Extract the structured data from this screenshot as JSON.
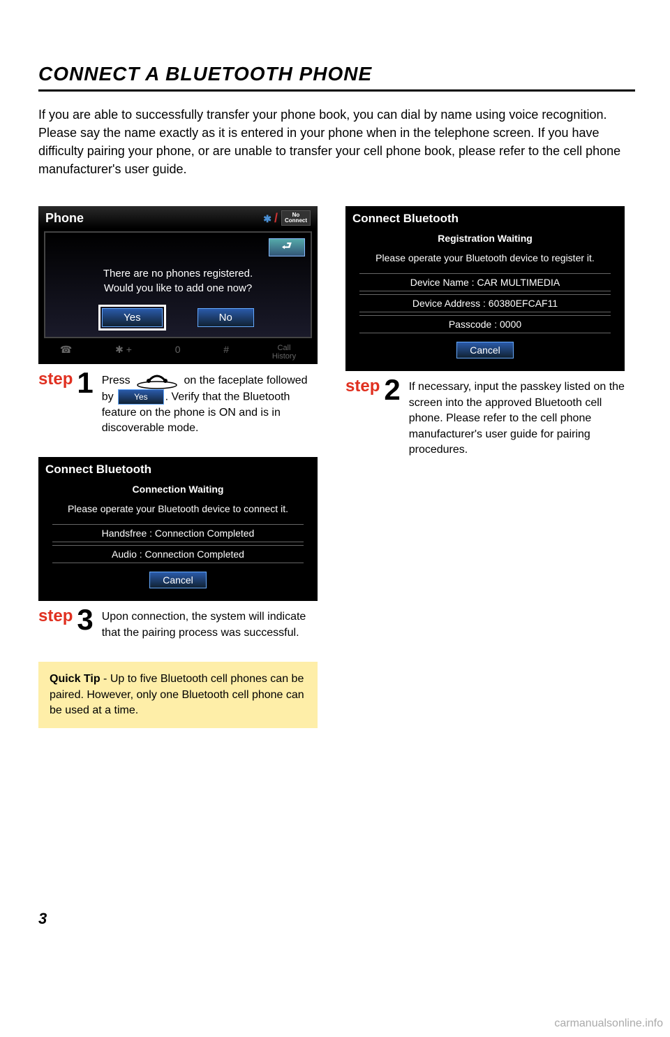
{
  "title": "CONNECT A BLUETOOTH PHONE",
  "intro": "If you are able to successfully transfer your phone book, you can dial by name using voice recognition. Please say the name exactly as it is entered in your phone when in the telephone screen. If you have difficulty pairing your phone, or are unable to transfer your cell phone book, please refer to the cell phone manufacturer's user guide.",
  "screenshot1": {
    "header": "Phone",
    "no_connect": "No\nConnect",
    "line1": "There are no phones registered.",
    "line2": "Would you like to add one now?",
    "yes": "Yes",
    "no": "No",
    "footer_items": [
      "☎",
      "✱ +",
      "0",
      "#"
    ],
    "call_history": "Call\nHistory"
  },
  "screenshot2": {
    "title": "Connect Bluetooth",
    "subtitle": "Registration Waiting",
    "instruction": "Please operate your Bluetooth device to register it.",
    "device_name": "Device Name : CAR MULTIMEDIA",
    "device_addr": "Device Address : 60380EFCAF11",
    "passcode": "Passcode : 0000",
    "cancel": "Cancel"
  },
  "screenshot3": {
    "title": "Connect Bluetooth",
    "subtitle": "Connection Waiting",
    "instruction": "Please operate your Bluetooth device to connect it.",
    "handsfree": "Handsfree : Connection Completed",
    "audio": "Audio : Connection Completed",
    "cancel": "Cancel"
  },
  "steps": {
    "label": "step",
    "s1_pre": "Press",
    "s1_mid1": "on the faceplate followed by",
    "s1_yes": "Yes",
    "s1_post": ". Verify that the Bluetooth feature on the phone is ON and is in discoverable mode.",
    "s2": "If necessary, input the passkey listed on the screen into the approved Bluetooth cell phone.  Please refer to the cell phone manufacturer's user guide for pairing procedures.",
    "s3": "Upon connection, the system will indicate that the pairing process was successful."
  },
  "quick_tip_label": "Quick Tip",
  "quick_tip_text": " - Up to five Bluetooth cell phones can be paired. However, only one Bluetooth cell phone can be used at a time.",
  "page_number": "3",
  "watermark": "carmanualsonline.info"
}
